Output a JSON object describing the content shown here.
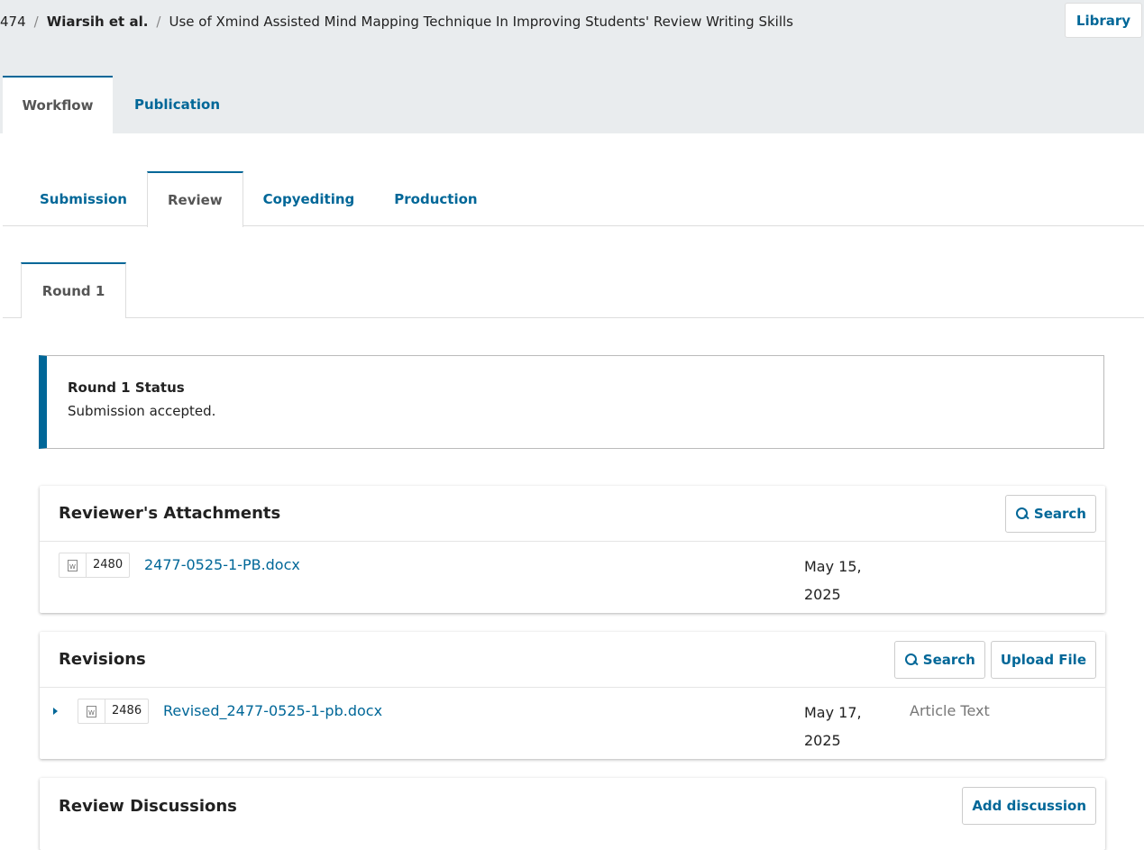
{
  "breadcrumb": {
    "id": "474",
    "author": "Wiarsih et al.",
    "title": "Use of Xmind Assisted Mind Mapping Technique In Improving Students' Review Writing Skills",
    "separator": "/"
  },
  "header": {
    "library_label": "Library"
  },
  "main_tabs": [
    {
      "label": "Workflow",
      "active": true
    },
    {
      "label": "Publication",
      "active": false
    }
  ],
  "stage_tabs": [
    {
      "label": "Submission"
    },
    {
      "label": "Review"
    },
    {
      "label": "Copyediting"
    },
    {
      "label": "Production"
    }
  ],
  "round_tab": {
    "label": "Round 1"
  },
  "status": {
    "title": "Round 1 Status",
    "text": "Submission accepted."
  },
  "reviewer_attachments": {
    "title": "Reviewer's Attachments",
    "search_label": "Search",
    "files": [
      {
        "id": "2480",
        "name": "2477-0525-1-PB.docx",
        "date": "May 15, 2025"
      }
    ]
  },
  "revisions": {
    "title": "Revisions",
    "search_label": "Search",
    "upload_label": "Upload File",
    "files": [
      {
        "id": "2486",
        "name": "Revised_2477-0525-1-pb.docx",
        "date": "May 17, 2025",
        "type": "Article Text"
      }
    ]
  },
  "review_discussions": {
    "title": "Review Discussions",
    "add_label": "Add discussion"
  },
  "colors": {
    "accent": "#006798",
    "header_bg": "#e9ecee"
  },
  "icons": {
    "search": "search-icon",
    "file": "docx-file-icon",
    "expand": "expand-triangle-icon"
  }
}
